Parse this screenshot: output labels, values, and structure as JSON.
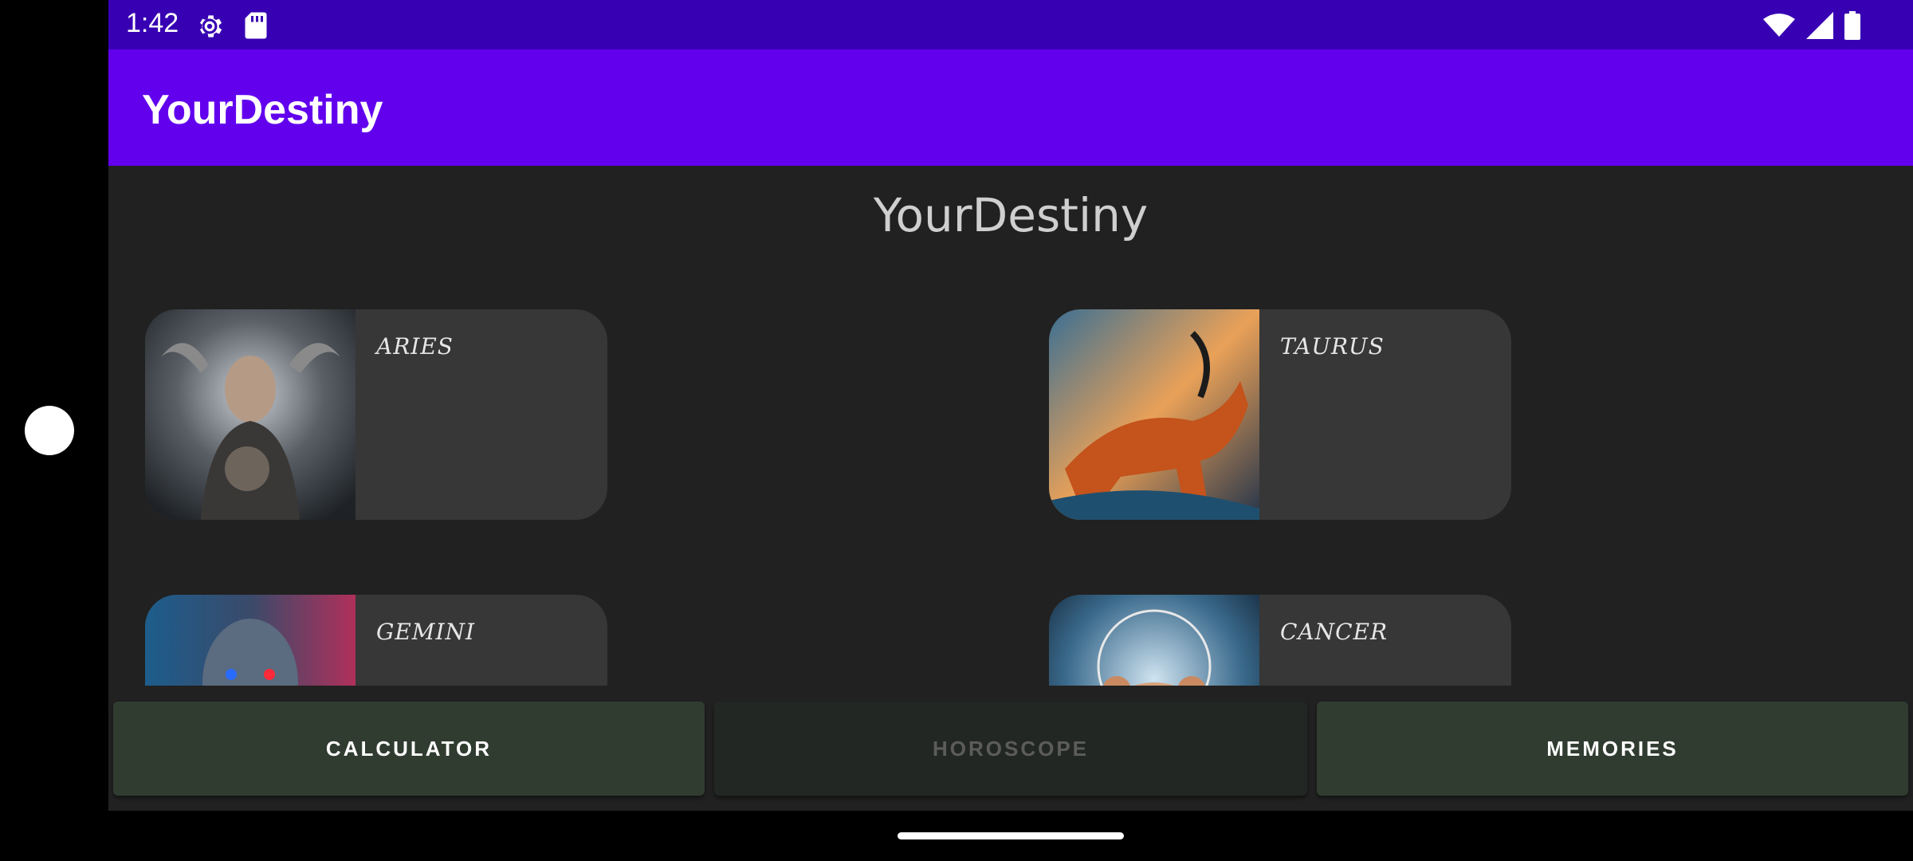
{
  "status_bar": {
    "time": "1:42",
    "icons": [
      "settings-gear-icon",
      "sd-card-icon",
      "wifi-icon",
      "signal-icon",
      "battery-icon"
    ]
  },
  "app_bar": {
    "title": "YourDestiny"
  },
  "content": {
    "title": "YourDestiny",
    "signs": [
      {
        "label": "ARIES"
      },
      {
        "label": "TAURUS"
      },
      {
        "label": "GEMINI"
      },
      {
        "label": "CANCER"
      }
    ]
  },
  "bottom_nav": {
    "calculator": "CALCULATOR",
    "horoscope": "HOROSCOPE",
    "memories": "MEMORIES"
  },
  "colors": {
    "status_bar": "#3700B3",
    "app_bar": "#6200EE",
    "background": "#212121",
    "card": "#373737",
    "button": "#303c30",
    "button_disabled": "#232723"
  }
}
